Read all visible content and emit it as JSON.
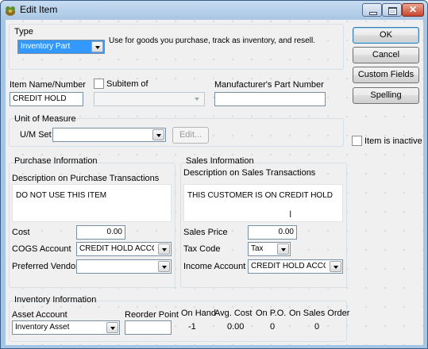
{
  "window": {
    "title": "Edit Item"
  },
  "type_section": {
    "label": "Type",
    "selected": "Inventory Part",
    "description": "Use for goods you purchase, track as inventory, and resell."
  },
  "buttons": {
    "ok": "OK",
    "cancel": "Cancel",
    "custom_fields": "Custom Fields",
    "spelling": "Spelling"
  },
  "item": {
    "name_label": "Item Name/Number",
    "name_value": "CREDIT HOLD",
    "subitem_label": "Subitem of",
    "subitem_value": "",
    "mfr_label": "Manufacturer's Part Number",
    "mfr_value": ""
  },
  "uom": {
    "group_label": "Unit of Measure",
    "set_label": "U/M Set",
    "set_value": "",
    "edit_label": "Edit..."
  },
  "inactive_label": "Item is inactive",
  "purchase": {
    "group_label": "Purchase Information",
    "desc_label": "Description on Purchase Transactions",
    "desc_value": "DO NOT USE THIS ITEM",
    "cost_label": "Cost",
    "cost_value": "0.00",
    "cogs_label": "COGS Account",
    "cogs_value": "CREDIT HOLD ACCO...",
    "vendor_label": "Preferred Vendor",
    "vendor_value": ""
  },
  "sales": {
    "group_label": "Sales Information",
    "desc_label": "Description on Sales Transactions",
    "desc_value": "THIS CUSTOMER IS ON CREDIT HOLD",
    "price_label": "Sales Price",
    "price_value": "0.00",
    "tax_label": "Tax Code",
    "tax_value": "Tax",
    "income_label": "Income Account",
    "income_value": "CREDIT HOLD ACCO..."
  },
  "inventory": {
    "group_label": "Inventory Information",
    "asset_label": "Asset Account",
    "asset_value": "Inventory Asset",
    "reorder_label": "Reorder Point",
    "reorder_value": "",
    "on_hand_label": "On Hand",
    "on_hand_value": "-1",
    "avg_cost_label": "Avg. Cost",
    "avg_cost_value": "0.00",
    "on_po_label": "On P.O.",
    "on_po_value": "0",
    "on_sales_order_label": "On Sales Order",
    "on_sales_order_value": "0"
  },
  "colors": {
    "title_bar": "#a9c6e4",
    "selection": "#3399ff",
    "close_button": "#c8452d"
  }
}
